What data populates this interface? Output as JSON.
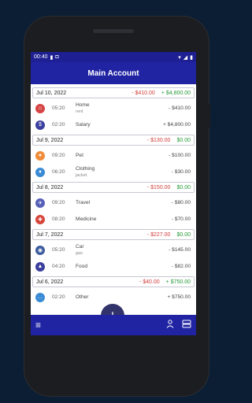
{
  "status": {
    "time": "00:40"
  },
  "header": {
    "title": "Main Account"
  },
  "days": [
    {
      "date": "Jul 10, 2022",
      "expense": "- $410.00",
      "income": "+ $4,800.00",
      "rows": [
        {
          "icon": "home-icon",
          "color": "#d64545",
          "time": "05:20",
          "category": "Home",
          "note": "rent",
          "amount": "- $410.00"
        },
        {
          "icon": "salary-icon",
          "color": "#3b3f9e",
          "time": "02:20",
          "category": "Salary",
          "note": "",
          "amount": "+ $4,800.00"
        }
      ]
    },
    {
      "date": "Jul 9, 2022",
      "expense": "- $130.00",
      "income": "$0.00",
      "rows": [
        {
          "icon": "pet-icon",
          "color": "#f08c3a",
          "time": "09:20",
          "category": "Pet",
          "note": "",
          "amount": "- $100.00"
        },
        {
          "icon": "clothing-icon",
          "color": "#3a8bd6",
          "time": "06:20",
          "category": "Clothing",
          "note": "jacket",
          "amount": "- $30.00"
        }
      ]
    },
    {
      "date": "Jul 8, 2022",
      "expense": "- $150.00",
      "income": "$0.00",
      "rows": [
        {
          "icon": "travel-icon",
          "color": "#5660b8",
          "time": "09:20",
          "category": "Travel",
          "note": "",
          "amount": "- $80.00"
        },
        {
          "icon": "medicine-icon",
          "color": "#d6453a",
          "time": "08:20",
          "category": "Medicine",
          "note": "",
          "amount": "- $70.00"
        }
      ]
    },
    {
      "date": "Jul 7, 2022",
      "expense": "- $227.00",
      "income": "$0.00",
      "rows": [
        {
          "icon": "car-icon",
          "color": "#3c5c9e",
          "time": "05:20",
          "category": "Car",
          "note": "gas",
          "amount": "- $145.00"
        },
        {
          "icon": "food-icon",
          "color": "#3b3f9e",
          "time": "04:20",
          "category": "Food",
          "note": "",
          "amount": "- $82.00"
        }
      ]
    },
    {
      "date": "Jul 6, 2022",
      "expense": "- $40.00",
      "income": "+ $750.00",
      "rows": [
        {
          "icon": "other-icon",
          "color": "#3a8bd6",
          "time": "02:20",
          "category": "Other",
          "note": "",
          "amount": "+ $750.00"
        }
      ]
    }
  ],
  "fab": {
    "label": "+"
  }
}
